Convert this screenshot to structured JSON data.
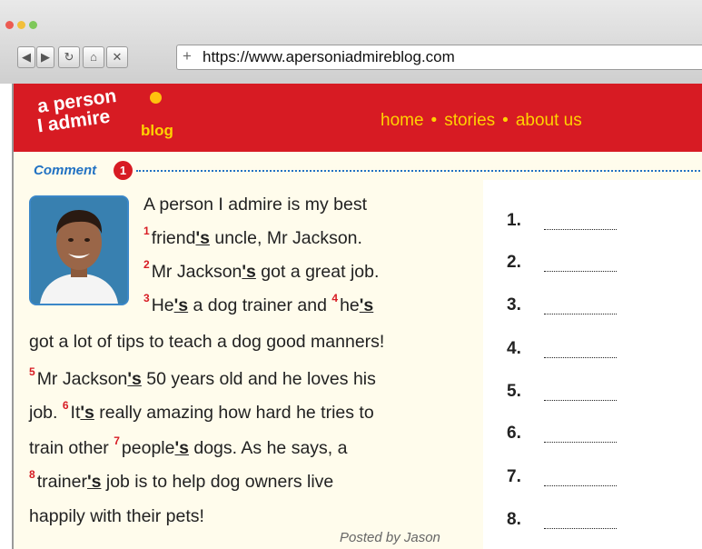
{
  "browser": {
    "back_icon": "◀",
    "forward_icon": "▶",
    "reload_icon": "↻",
    "home_icon": "⌂",
    "close_icon": "✕",
    "new_tab_icon": "+",
    "url": "https://www.apersoniadmireblog.com"
  },
  "site": {
    "logo_line1": "a person",
    "logo_line2": "I admire",
    "logo_blog": "blog",
    "nav": [
      "home",
      "stories",
      "about us"
    ],
    "nav_separator": "•"
  },
  "comment": {
    "label": "Comment",
    "number": "1"
  },
  "post": {
    "n1": "1",
    "n2": "2",
    "n3": "3",
    "n4": "4",
    "n5": "5",
    "n6": "6",
    "n7": "7",
    "n8": "8",
    "line1": "A person I admire is my best",
    "l2a": "friend",
    "l2u": "'s",
    "l2b": " uncle, Mr Jackson.",
    "l3a": "Mr Jackson",
    "l3u": "'s",
    "l3b": " got a great job.",
    "l4a": "He",
    "l4u": "'s",
    "l4b": " a dog trainer and ",
    "l4c": "he",
    "l4u2": "'s",
    "line5": "got a lot of tips to teach a dog good manners!",
    "l6a": "Mr Jackson",
    "l6u": "'s",
    "l6b": " 50 years old and he loves his",
    "l7a": "job. ",
    "l7b": "It",
    "l7u": "'s",
    "l7c": " really amazing how hard he tries to",
    "l8a": "train other ",
    "l8b": "people",
    "l8u": "'s",
    "l8c": " dogs. As he says, a",
    "l9a": "trainer",
    "l9u": "'s",
    "l9b": " job is to help dog owners live",
    "line10": "happily with their pets!",
    "posted_by": "Posted by Jason"
  },
  "answers": [
    "1.",
    "2.",
    "3.",
    "4.",
    "5.",
    "6.",
    "7.",
    "8."
  ],
  "colors": {
    "header_red": "#d71b23",
    "nav_yellow": "#ffd200",
    "comment_blue": "#2272c3",
    "page_cream": "#fffcec"
  }
}
